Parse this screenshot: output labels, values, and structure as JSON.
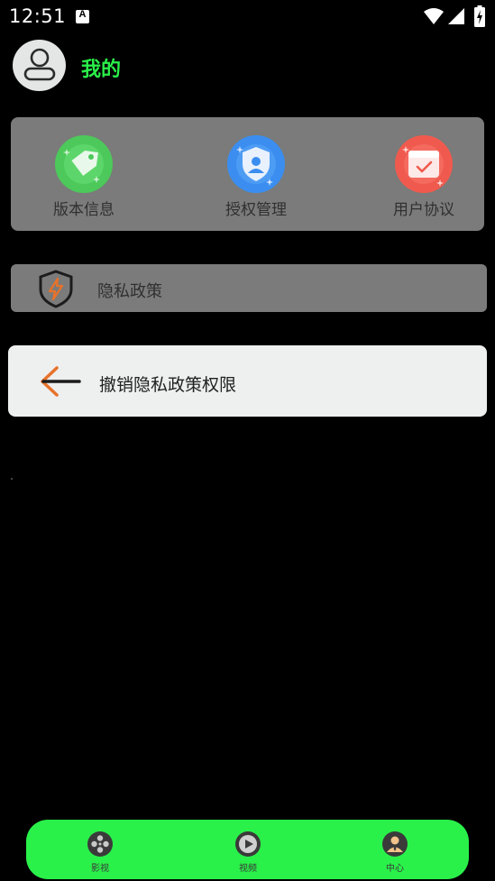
{
  "status_bar": {
    "time": "12:51",
    "notification_icon": "a-icon",
    "icons": [
      "wifi-icon",
      "signal-icon",
      "battery-charging-icon"
    ]
  },
  "profile": {
    "avatar_icon": "person-icon",
    "name": "我的",
    "name_color": "#2af04a"
  },
  "grid": {
    "items": [
      {
        "label": "版本信息",
        "icon": "tag-icon",
        "color": "#4cc95a"
      },
      {
        "label": "授权管理",
        "icon": "shield-user-icon",
        "color": "#3b8ef0"
      },
      {
        "label": "用户协议",
        "icon": "calendar-check-icon",
        "color": "#f05a4e"
      }
    ]
  },
  "privacy": {
    "label": "隐私政策",
    "icon": "shield-bolt-icon"
  },
  "revoke": {
    "label": "撤销隐私政策权限",
    "icon": "arrow-left-icon"
  },
  "bottom_nav": {
    "background": "#2af04a",
    "items": [
      {
        "label": "影视",
        "icon": "film-reel-icon"
      },
      {
        "label": "视频",
        "icon": "play-circle-icon"
      },
      {
        "label": "中心",
        "icon": "user-center-icon"
      }
    ]
  }
}
